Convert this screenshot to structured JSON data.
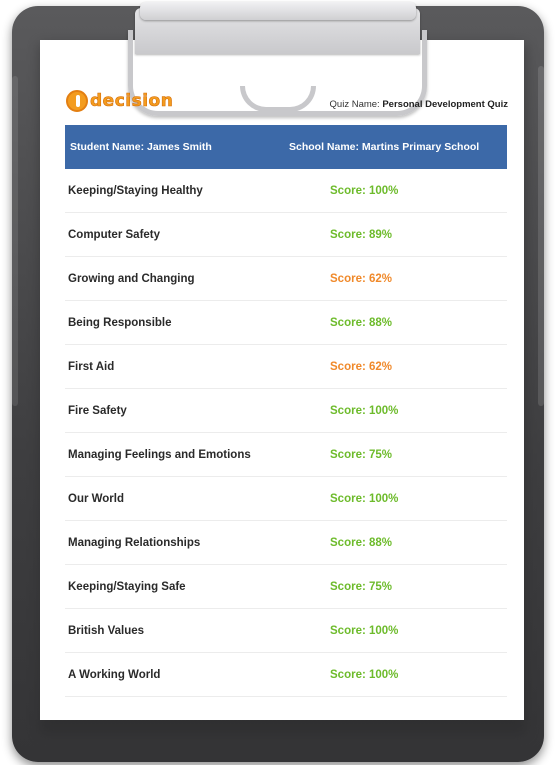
{
  "brand": {
    "logo_text": "decision",
    "accent": "#f39c1f"
  },
  "quiz": {
    "label": "Quiz Name:",
    "name": "Personal Development Quiz"
  },
  "header": {
    "student": "Student Name: James Smith",
    "school": "School Name: Martins Primary School",
    "color": "#3c69a8"
  },
  "colors": {
    "high": "#6dbb2b",
    "medium": "#f0892a"
  },
  "results": [
    {
      "subject": "Keeping/Staying Healthy",
      "score": "Score: 100%",
      "level": "high"
    },
    {
      "subject": "Computer Safety",
      "score": "Score: 89%",
      "level": "high"
    },
    {
      "subject": "Growing and Changing",
      "score": "Score: 62%",
      "level": "medium"
    },
    {
      "subject": "Being Responsible",
      "score": "Score: 88%",
      "level": "high"
    },
    {
      "subject": "First Aid",
      "score": "Score: 62%",
      "level": "medium"
    },
    {
      "subject": "Fire Safety",
      "score": "Score: 100%",
      "level": "high"
    },
    {
      "subject": "Managing Feelings and Emotions",
      "score": "Score: 75%",
      "level": "high"
    },
    {
      "subject": "Our World",
      "score": "Score: 100%",
      "level": "high"
    },
    {
      "subject": "Managing Relationships",
      "score": "Score: 88%",
      "level": "high"
    },
    {
      "subject": "Keeping/Staying Safe",
      "score": "Score: 75%",
      "level": "high"
    },
    {
      "subject": "British Values",
      "score": "Score: 100%",
      "level": "high"
    },
    {
      "subject": "A Working World",
      "score": "Score: 100%",
      "level": "high"
    }
  ]
}
